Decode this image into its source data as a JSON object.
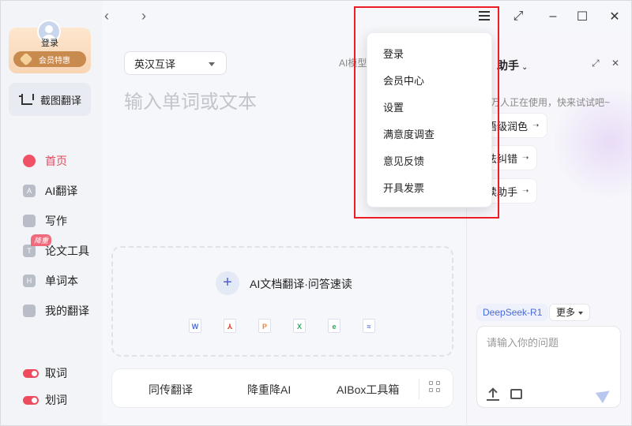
{
  "sidebar": {
    "login_label": "登录",
    "vip_label": "会员特惠",
    "screenshot_label": "截图翻译",
    "nav": [
      {
        "label": "首页",
        "icon": "home-icon",
        "active": true
      },
      {
        "label": "AI翻译",
        "icon": "ai-translate-icon",
        "icon_text": "A"
      },
      {
        "label": "写作",
        "icon": "pen-icon"
      },
      {
        "label": "论文工具",
        "icon": "paper-icon",
        "icon_text": "T",
        "badge": "降重"
      },
      {
        "label": "单词本",
        "icon": "wordbook-icon",
        "icon_text": "H"
      },
      {
        "label": "我的翻译",
        "icon": "my-translation-icon"
      }
    ],
    "toggles": [
      {
        "label": "取词"
      },
      {
        "label": "划词"
      }
    ]
  },
  "main": {
    "lang_select": "英汉互译",
    "ai_model_label": "AI模型",
    "input_placeholder": "输入单词或文本",
    "doc_upload_title": "AI文档翻译·问答速读",
    "file_types": [
      {
        "name": "word-file-icon",
        "glyph": "W",
        "color": "#4a6bd8"
      },
      {
        "name": "pdf-file-icon",
        "glyph": "⅄",
        "color": "#e3543c"
      },
      {
        "name": "ppt-file-icon",
        "glyph": "P",
        "color": "#f0833a"
      },
      {
        "name": "excel-file-icon",
        "glyph": "X",
        "color": "#2fa65a"
      },
      {
        "name": "epub-file-icon",
        "glyph": "e",
        "color": "#2fa65a"
      },
      {
        "name": "image-file-icon",
        "glyph": "≈",
        "color": "#4a6bd8"
      }
    ],
    "bottom_tabs": [
      "同传翻译",
      "降重降AI",
      "AIBox工具箱"
    ]
  },
  "right_panel": {
    "title": "助手",
    "hint": "万人正在使用，快来试试吧~",
    "chips": [
      "语级润色",
      "法纠错",
      "读助手"
    ],
    "model": "DeepSeek-R1",
    "more": "更多",
    "chat_placeholder": "请输入你的问题"
  },
  "menu": {
    "items": [
      "登录",
      "会员中心",
      "设置",
      "满意度调查",
      "意见反馈",
      "开具发票"
    ]
  },
  "colors": {
    "accent_red": "#ef5165",
    "highlight_frame": "#ee1c25",
    "link_blue": "#4a6bd8"
  }
}
